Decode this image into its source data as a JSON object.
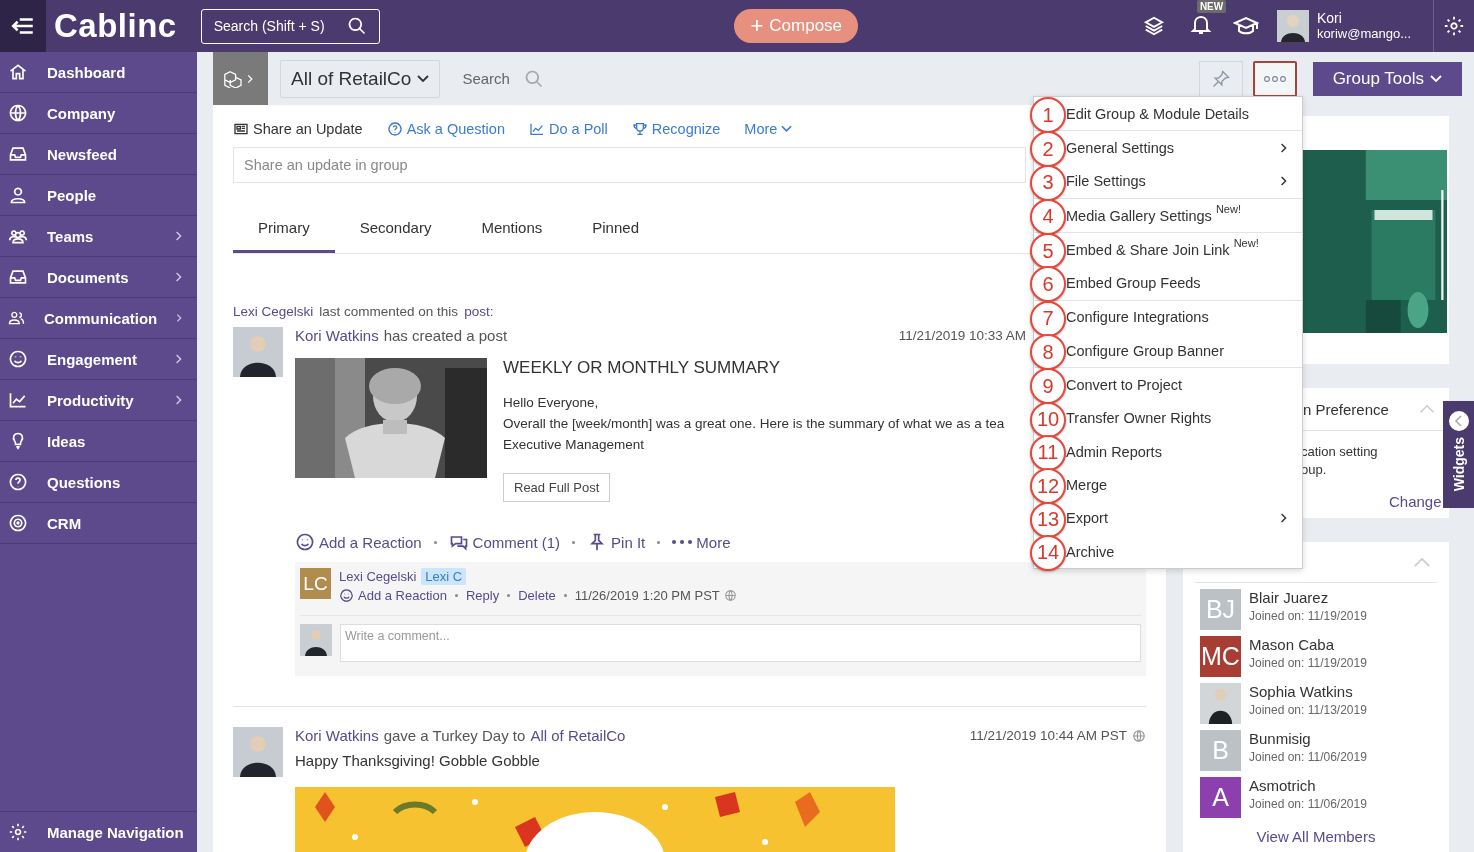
{
  "topbar": {
    "logo": "Cablinc",
    "search": "Search (Shift + S)",
    "compose_icon": "+",
    "compose": "Compose",
    "badge": "NEW",
    "user": {
      "name": "Kori",
      "email": "koriw@mango..."
    }
  },
  "sidebar": {
    "items": [
      {
        "label": "Dashboard",
        "submenu": false
      },
      {
        "label": "Company",
        "submenu": false
      },
      {
        "label": "Newsfeed",
        "submenu": false
      },
      {
        "label": "People",
        "submenu": false
      },
      {
        "label": "Teams",
        "submenu": true
      },
      {
        "label": "Documents",
        "submenu": true
      },
      {
        "label": "Communication",
        "submenu": true
      },
      {
        "label": "Engagement",
        "submenu": true
      },
      {
        "label": "Productivity",
        "submenu": true
      },
      {
        "label": "Ideas",
        "submenu": false
      },
      {
        "label": "Questions",
        "submenu": false
      },
      {
        "label": "CRM",
        "submenu": false
      }
    ],
    "footer": "Manage Navigation"
  },
  "subheader": {
    "group": "All of RetailCo",
    "search": "Search",
    "group_tools": "Group Tools"
  },
  "composer": {
    "actions": [
      "Share an Update",
      "Ask a Question",
      "Do a Poll",
      "Recognize"
    ],
    "more": "More",
    "placeholder": "Share an update in group"
  },
  "tabs": [
    {
      "label": "Primary",
      "selected": true
    },
    {
      "label": "Secondary",
      "selected": false
    },
    {
      "label": "Mentions",
      "selected": false
    },
    {
      "label": "Pinned",
      "selected": false
    }
  ],
  "post": {
    "activity": {
      "actor": "Lexi Cegelski",
      "text": "last commented on this",
      "link": "post",
      "suffix": ":"
    },
    "author": "Kori Watkins",
    "action": "has created a post",
    "time": "11/21/2019 10:33 AM",
    "title": "WEEKLY OR MONTHLY SUMMARY",
    "body": [
      "Hello Everyone,",
      "Overall the [week/month] was a great one. Here is the summary of what we as a tea",
      "Executive Management"
    ],
    "read_more": "Read Full Post",
    "actions": [
      "Add a Reaction",
      "Comment (1)",
      "Pin It",
      "More"
    ],
    "comment": {
      "initials": "LC",
      "color": "#b08d4f",
      "author": "Lexi Cegelski",
      "tag": "Lexi C",
      "actions": [
        "Add a Reaction",
        "Reply",
        "Delete"
      ],
      "time": "11/26/2019 1:20 PM PST"
    },
    "comment_placeholder": "Write a comment..."
  },
  "post2": {
    "author": "Kori Watkins",
    "action": "gave a Turkey Day to",
    "target": "All of RetailCo",
    "time": "11/21/2019 10:44 AM PST",
    "text": "Happy Thanksgiving! Gobble Gobble"
  },
  "menu": {
    "groups": [
      [
        {
          "number": "1",
          "label": "Edit Group & Module Details",
          "submenu": false
        }
      ],
      [
        {
          "number": "2",
          "label": "General Settings",
          "submenu": true
        },
        {
          "number": "3",
          "label": "File Settings",
          "submenu": true
        }
      ],
      [
        {
          "number": "4",
          "label": "Media Gallery Settings",
          "submenu": false,
          "badge": "New!"
        }
      ],
      [
        {
          "number": "5",
          "label": "Embed & Share Join Link",
          "submenu": false,
          "badge": "New!"
        },
        {
          "number": "6",
          "label": "Embed Group Feeds",
          "submenu": false
        }
      ],
      [
        {
          "number": "7",
          "label": "Configure Integrations",
          "submenu": false
        },
        {
          "number": "8",
          "label": "Configure Group Banner",
          "submenu": false
        }
      ],
      [
        {
          "number": "9",
          "label": "Convert to Project",
          "submenu": false
        },
        {
          "number": "10",
          "label": "Transfer Owner Rights",
          "submenu": false
        },
        {
          "number": "11",
          "label": "Admin Reports",
          "submenu": false
        },
        {
          "number": "12",
          "label": "Merge",
          "submenu": false
        },
        {
          "number": "13",
          "label": "Export",
          "submenu": true
        },
        {
          "number": "14",
          "label": "Archive",
          "submenu": false
        }
      ]
    ]
  },
  "widgets": {
    "preference": {
      "title": "n Preference",
      "lines": [
        "cation setting",
        "oup."
      ],
      "link": "Change"
    },
    "joinees": {
      "members": [
        {
          "kind": "initials",
          "initials": "BJ",
          "color": "#bcc1c6",
          "name": "Blair Juarez",
          "joined": "Joined on: 11/19/2019"
        },
        {
          "kind": "initials",
          "initials": "MC",
          "color": "#a83e33",
          "name": "Mason Caba",
          "joined": "Joined on: 11/19/2019"
        },
        {
          "name": "Sophia Watkins",
          "joined": "Joined on: 11/13/2019"
        },
        {
          "kind": "initials",
          "initials": "B",
          "color": "#bcc1c6",
          "name": "Bunmisig",
          "joined": "Joined on: 11/06/2019"
        },
        {
          "kind": "initials",
          "initials": "A",
          "color": "#8d3fae",
          "name": "Asmotrich",
          "joined": "Joined on: 11/06/2019"
        }
      ],
      "view_all": "View All Members"
    },
    "tab": "Widgets"
  }
}
